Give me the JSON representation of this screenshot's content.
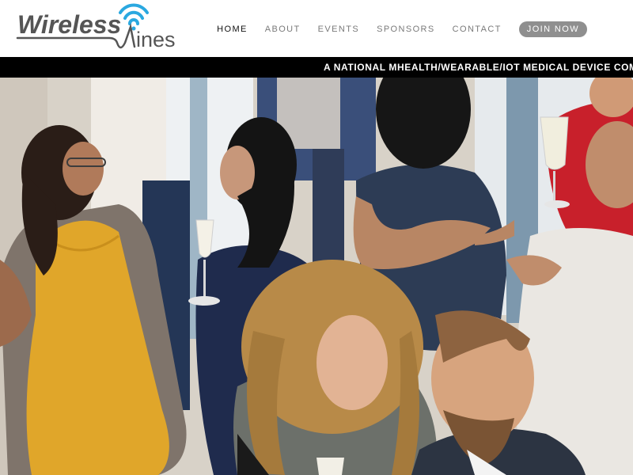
{
  "brand": {
    "logo_text_primary": "Wireless",
    "logo_text_secondary": "ines",
    "wifi_color": "#2aa8e0",
    "logo_color": "#555555"
  },
  "nav": {
    "items": [
      {
        "label": "HOME",
        "active": true
      },
      {
        "label": "ABOUT",
        "active": false
      },
      {
        "label": "EVENTS",
        "active": false
      },
      {
        "label": "SPONSORS",
        "active": false
      },
      {
        "label": "CONTACT",
        "active": false
      }
    ],
    "join_label": "JOIN NOW"
  },
  "tagline": "A NATIONAL MHEALTH/WEARABLE/IOT MEDICAL DEVICE COMMU",
  "colors": {
    "bar_bg": "#000000",
    "join_bg": "#8f8f8f",
    "dress_yellow": "#e0a62a"
  }
}
